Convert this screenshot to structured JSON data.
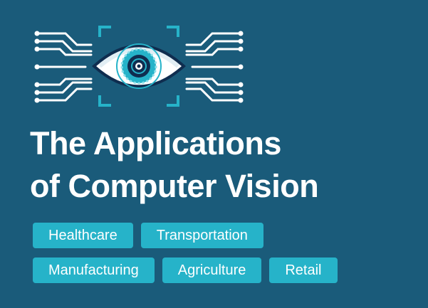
{
  "title": {
    "line1": "The Applications",
    "line2": "of Computer Vision"
  },
  "tags": {
    "row1": [
      "Healthcare",
      "Transportation"
    ],
    "row2": [
      "Manufacturing",
      "Agriculture",
      "Retail"
    ]
  },
  "graphic": {
    "icon": "eye-circuit-icon",
    "colors": {
      "background": "#1a5b7a",
      "accent": "#26b3c9",
      "white": "#ffffff",
      "navy": "#0f2d4f"
    }
  }
}
